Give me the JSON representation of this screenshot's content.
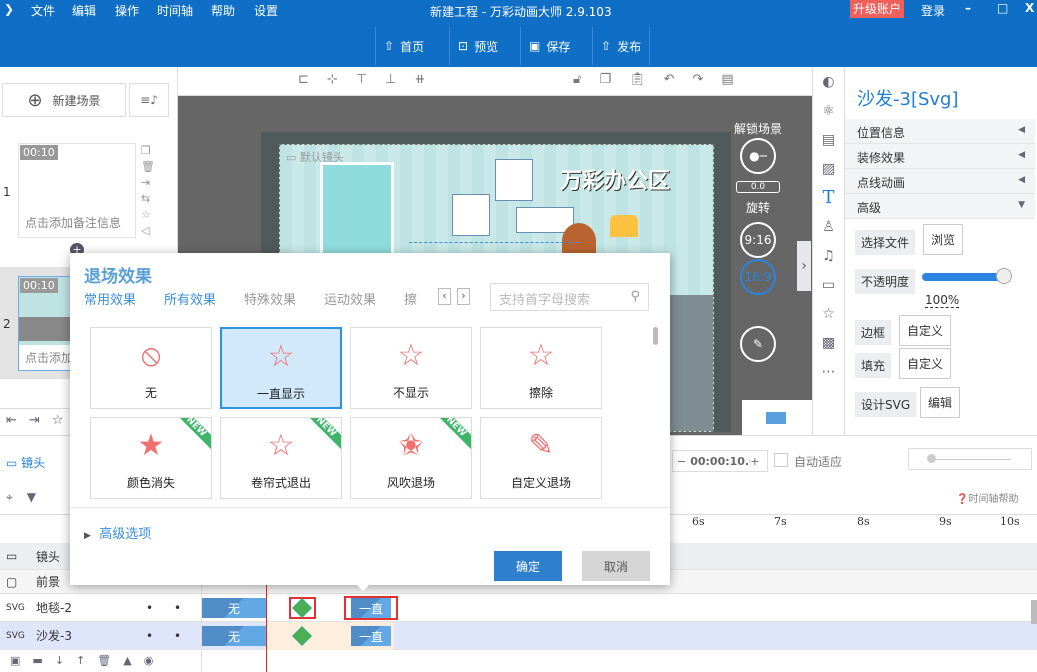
{
  "app": {
    "title": "新建工程 - 万彩动画大师 2.9.103",
    "menu": [
      "文件",
      "编辑",
      "操作",
      "时间轴",
      "帮助",
      "设置"
    ],
    "upgrade": "升级账户",
    "login": "登录",
    "minimize": "–",
    "maximize": "□",
    "close": "X"
  },
  "toolbar": [
    {
      "icon": "home-icon",
      "label": "首页"
    },
    {
      "icon": "preview-icon",
      "label": "预览"
    },
    {
      "icon": "save-icon",
      "label": "保存"
    },
    {
      "icon": "publish-icon",
      "label": "发布"
    }
  ],
  "left": {
    "new_scene": "新建场景",
    "scenes": [
      {
        "num": "1",
        "duration": "00:10",
        "note": "点击添加备注信息"
      },
      {
        "num": "2",
        "duration": "00:10",
        "note": "点击添加备注信息"
      }
    ]
  },
  "canvas": {
    "camera_label": "默认镜头",
    "scene_title": "万彩办公区",
    "unlock": "解锁场景",
    "rotation": "0.0",
    "rotate_label": "旋转",
    "ratio_916": "9:16",
    "ratio_169": "16:9"
  },
  "props": {
    "title": "沙发-3[Svg]",
    "sections": [
      "位置信息",
      "装修效果",
      "点线动画",
      "高级"
    ],
    "choose_file": "选择文件",
    "browse": "浏览",
    "opacity_label": "不透明度",
    "opacity": "100%",
    "opacity_value": 100,
    "border": "边框",
    "border_btn": "自定义",
    "fill": "填充",
    "fill_btn": "自定义",
    "design_svg": "设计SVG",
    "edit": "编辑"
  },
  "timeline": {
    "camera_tab": "镜头",
    "duration": "00:00:10.0",
    "auto_fit": "自动适应",
    "help": "时间轴帮助",
    "ticks": [
      "6s",
      "7s",
      "8s",
      "9s",
      "10s"
    ],
    "rows": [
      {
        "name": "镜头"
      },
      {
        "name": "前景"
      },
      {
        "name": "地毯-2",
        "enter": "无",
        "exit": "一直"
      },
      {
        "name": "沙发-3",
        "enter": "无",
        "exit": "一直"
      }
    ]
  },
  "dialog": {
    "title": "退场效果",
    "tabs": [
      "常用效果",
      "所有效果",
      "特殊效果",
      "运动效果",
      "擦"
    ],
    "search_placeholder": "支持首字母搜索",
    "effects": [
      {
        "label": "无",
        "icon": "prohibited-icon"
      },
      {
        "label": "一直显示",
        "icon": "star-icon",
        "selected": true
      },
      {
        "label": "不显示",
        "icon": "star-prohibited-icon"
      },
      {
        "label": "擦除",
        "icon": "star-hand-icon"
      },
      {
        "label": "颜色消失",
        "icon": "star-fade-icon",
        "new": true
      },
      {
        "label": "卷帘式退出",
        "icon": "star-blinds-icon",
        "new": true
      },
      {
        "label": "风吹退场",
        "icon": "star-wind-icon",
        "new": true
      },
      {
        "label": "自定义退场",
        "icon": "pencil-icon"
      }
    ],
    "new_badge": "NEW",
    "advanced": "高级选项",
    "ok": "确定",
    "cancel": "取消"
  }
}
